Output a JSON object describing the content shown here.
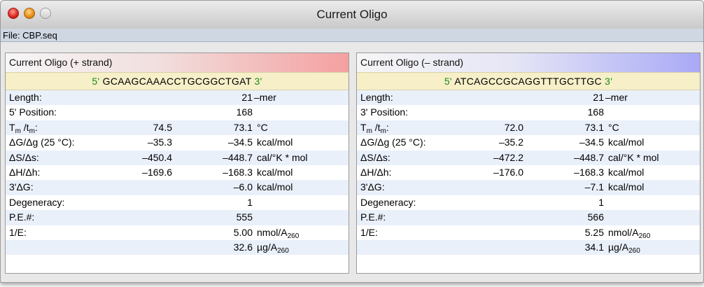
{
  "window": {
    "title": "Current Oligo",
    "file_label": "File: CBP.seq"
  },
  "plus": {
    "header": "Current Oligo (+ strand)",
    "seq_start": "5'",
    "sequence": "GCAAGCAAACCTGCGGCTGAT",
    "seq_end": "3'",
    "length_label": "Length:",
    "length_value": "21",
    "length_unit": "–mer",
    "position_label": "5' Position:",
    "position_value": "168",
    "tm_label_t1": "T",
    "tm_label_s1": "m",
    "tm_label_mid": " /t",
    "tm_label_s2": "m",
    "tm_label_end": ":",
    "tm_v1": "74.5",
    "tm_v2": "73.1",
    "tm_unit": "°C",
    "dg_label": "ΔG/Δg (25 °C):",
    "dg_v1": "–35.3",
    "dg_v2": "–34.5",
    "dg_unit": "kcal/mol",
    "ds_label": "ΔS/Δs:",
    "ds_v1": "–450.4",
    "ds_v2": "–448.7",
    "ds_unit": "cal/°K * mol",
    "dh_label": "ΔH/Δh:",
    "dh_v1": "–169.6",
    "dh_v2": "–168.3",
    "dh_unit": "kcal/mol",
    "dg3_label": "3'ΔG:",
    "dg3_v2": "–6.0",
    "dg3_unit": "kcal/mol",
    "deg_label": "Degeneracy:",
    "deg_v2": "1",
    "pe_label": "P.E.#:",
    "pe_v2": "555",
    "e_label": "1/E:",
    "e_v2": "5.00",
    "e_unit": "nmol/A",
    "e_unit_sub": "260",
    "ug_v2": "32.6",
    "ug_unit": "µg/A",
    "ug_unit_sub": "260"
  },
  "minus": {
    "header": "Current Oligo (– strand)",
    "seq_start": "5'",
    "sequence": "ATCAGCCGCAGGTTTGCTTGC",
    "seq_end": "3'",
    "length_label": "Length:",
    "length_value": "21",
    "length_unit": "–mer",
    "position_label": "3' Position:",
    "position_value": "168",
    "tm_label_t1": "T",
    "tm_label_s1": "m",
    "tm_label_mid": " /t",
    "tm_label_s2": "m",
    "tm_label_end": ":",
    "tm_v1": "72.0",
    "tm_v2": "73.1",
    "tm_unit": "°C",
    "dg_label": "ΔG/Δg (25 °C):",
    "dg_v1": "–35.2",
    "dg_v2": "–34.5",
    "dg_unit": "kcal/mol",
    "ds_label": "ΔS/Δs:",
    "ds_v1": "–472.2",
    "ds_v2": "–448.7",
    "ds_unit": "cal/°K * mol",
    "dh_label": "ΔH/Δh:",
    "dh_v1": "–176.0",
    "dh_v2": "–168.3",
    "dh_unit": "kcal/mol",
    "dg3_label": "3'ΔG:",
    "dg3_v2": "–7.1",
    "dg3_unit": "kcal/mol",
    "deg_label": "Degeneracy:",
    "deg_v2": "1",
    "pe_label": "P.E.#:",
    "pe_v2": "566",
    "e_label": "1/E:",
    "e_v2": "5.25",
    "e_unit": "nmol/A",
    "e_unit_sub": "260",
    "ug_v2": "34.1",
    "ug_unit": "µg/A",
    "ug_unit_sub": "260"
  },
  "colors": {
    "plus_header_accent": "#f4a0a0",
    "minus_header_accent": "#a9a9f6",
    "sequence_bg": "#f6efc8",
    "sequence_end": "#1c8a1c",
    "row_alt": "#eaf0fa"
  }
}
